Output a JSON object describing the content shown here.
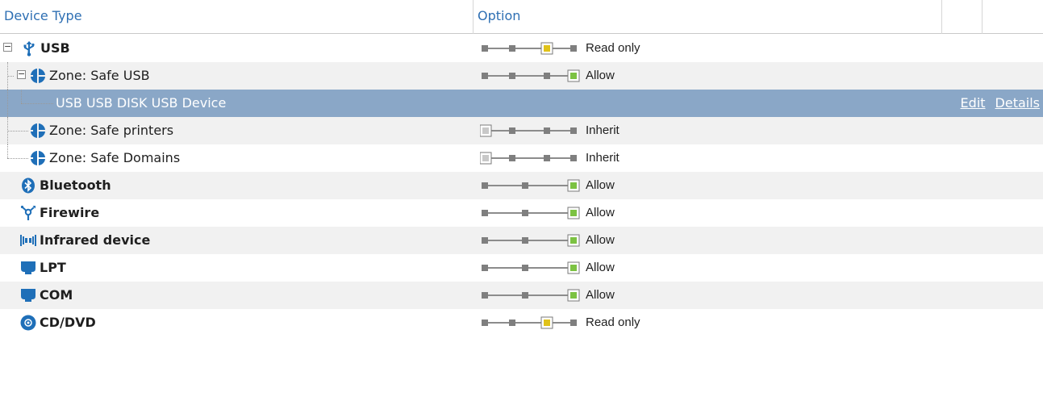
{
  "columns": {
    "device_type": "Device Type",
    "option": "Option"
  },
  "rows": [
    {
      "label": "USB",
      "bold": true,
      "level": 0,
      "expander": "minus",
      "icon": "usb-icon",
      "option": "Read only",
      "level_index": 2
    },
    {
      "label": "Zone: Safe USB",
      "bold": false,
      "level": 1,
      "expander": "minus",
      "icon": "zone-icon",
      "option": "Allow",
      "level_index": 3
    },
    {
      "label": "USB USB DISK USB Device",
      "bold": false,
      "level": 2,
      "expander": "",
      "icon": "",
      "option": "",
      "level_index": -1,
      "selected": true,
      "links": [
        "Edit",
        "Details"
      ]
    },
    {
      "label": "Zone: Safe printers",
      "bold": false,
      "level": 1,
      "expander": "",
      "icon": "zone-icon",
      "option": "Inherit",
      "level_index": 0
    },
    {
      "label": "Zone: Safe Domains",
      "bold": false,
      "level": 1,
      "expander": "",
      "icon": "zone-icon",
      "option": "Inherit",
      "level_index": 0
    },
    {
      "label": "Bluetooth",
      "bold": true,
      "level": 0,
      "expander": "",
      "icon": "bluetooth-icon",
      "option": "Allow",
      "level_index": 2,
      "short": true
    },
    {
      "label": "Firewire",
      "bold": true,
      "level": 0,
      "expander": "",
      "icon": "firewire-icon",
      "option": "Allow",
      "level_index": 2,
      "short": true
    },
    {
      "label": "Infrared device",
      "bold": true,
      "level": 0,
      "expander": "",
      "icon": "infrared-icon",
      "option": "Allow",
      "level_index": 2,
      "short": true
    },
    {
      "label": "LPT",
      "bold": true,
      "level": 0,
      "expander": "",
      "icon": "port-icon",
      "option": "Allow",
      "level_index": 2,
      "short": true
    },
    {
      "label": "COM",
      "bold": true,
      "level": 0,
      "expander": "",
      "icon": "port-icon",
      "option": "Allow",
      "level_index": 2,
      "short": true
    },
    {
      "label": "CD/DVD",
      "bold": true,
      "level": 0,
      "expander": "",
      "icon": "disc-icon",
      "option": "Read only",
      "level_index": 2
    }
  ],
  "colors": {
    "accent": "#2e6fb3",
    "icon": "#1f6fb8",
    "selected_row": "#8aa7c7",
    "allow": "#7cc242",
    "read_only": "#e0c21a",
    "inherit": "#c8c8c8"
  }
}
